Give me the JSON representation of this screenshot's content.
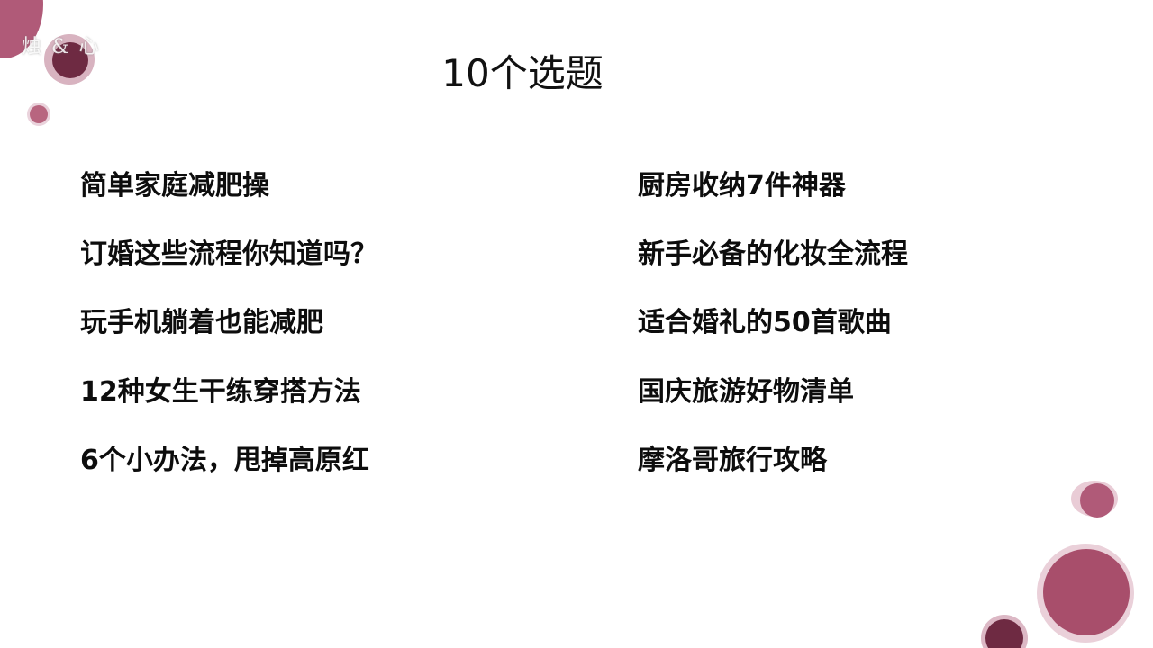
{
  "watermark": "烛 & 心",
  "title": "10个选题",
  "topics_left": [
    "简单家庭减肥操",
    "订婚这些流程你知道吗？",
    "玩手机躺着也能减肥",
    "12种女生干练穿搭方法",
    "6个小办法，甩掉高原红"
  ],
  "topics_right": [
    "厨房收纳7件神器",
    "新手必备的化妆全流程",
    "适合婚礼的50首歌曲",
    "国庆旅游好物清单",
    "摩洛哥旅行攻略"
  ],
  "colors": {
    "accent": "#a84e6b",
    "accent_light": "#e8c6d1",
    "dark_accent": "#6e2a42",
    "text": "#0d0d0d"
  }
}
